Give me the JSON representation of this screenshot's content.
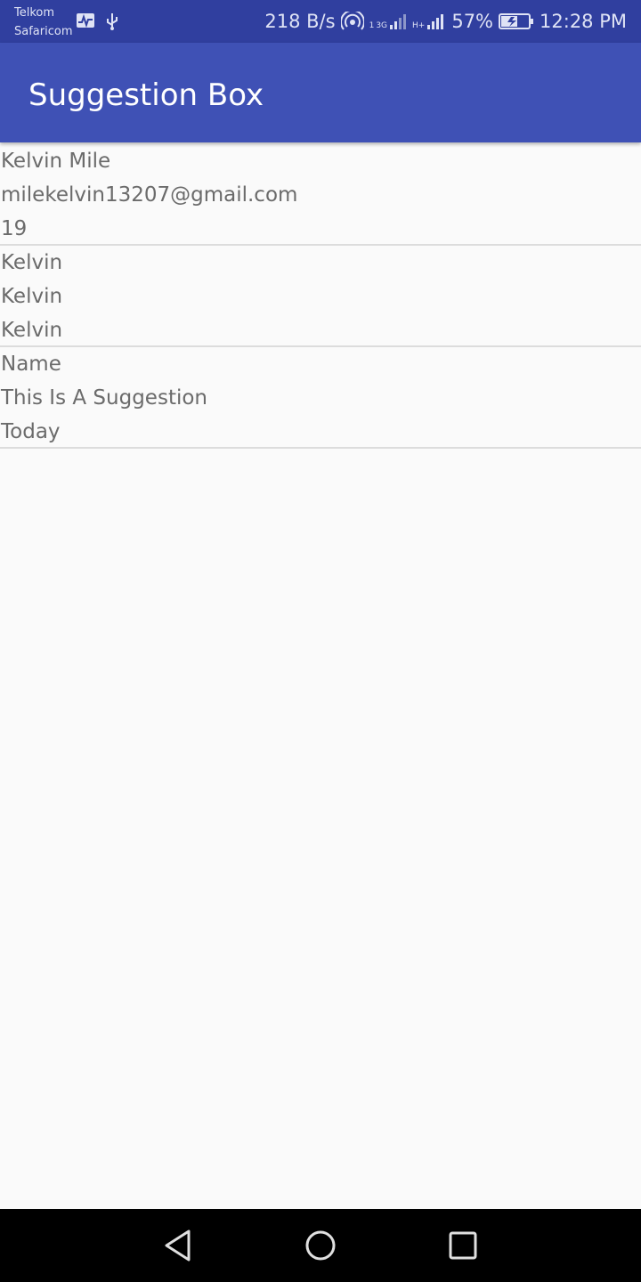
{
  "status_bar": {
    "carrier_1": "Telkom",
    "carrier_2": "Safaricom",
    "net_speed": "218 B/s",
    "sim1_label": "1",
    "sim1_network": "3G",
    "sim2_network": "H+",
    "battery": "57%",
    "time": "12:28 PM",
    "icons": [
      "activity-icon",
      "usb-icon",
      "hotspot-icon",
      "signal-icon",
      "battery-charging-icon"
    ]
  },
  "app_bar": {
    "title": "Suggestion Box",
    "color": "#3f51b5",
    "status_color": "#303f9f"
  },
  "suggestions": [
    {
      "name": "Kelvin Mile",
      "suggestion": "milekelvin13207@gmail.com",
      "date": "19"
    },
    {
      "name": "Kelvin",
      "suggestion": "Kelvin",
      "date": "Kelvin"
    },
    {
      "name": "Name",
      "suggestion": "This Is A Suggestion",
      "date": "Today"
    }
  ],
  "nav_bar": {
    "icons": [
      "back-icon",
      "home-icon",
      "recents-icon"
    ]
  }
}
